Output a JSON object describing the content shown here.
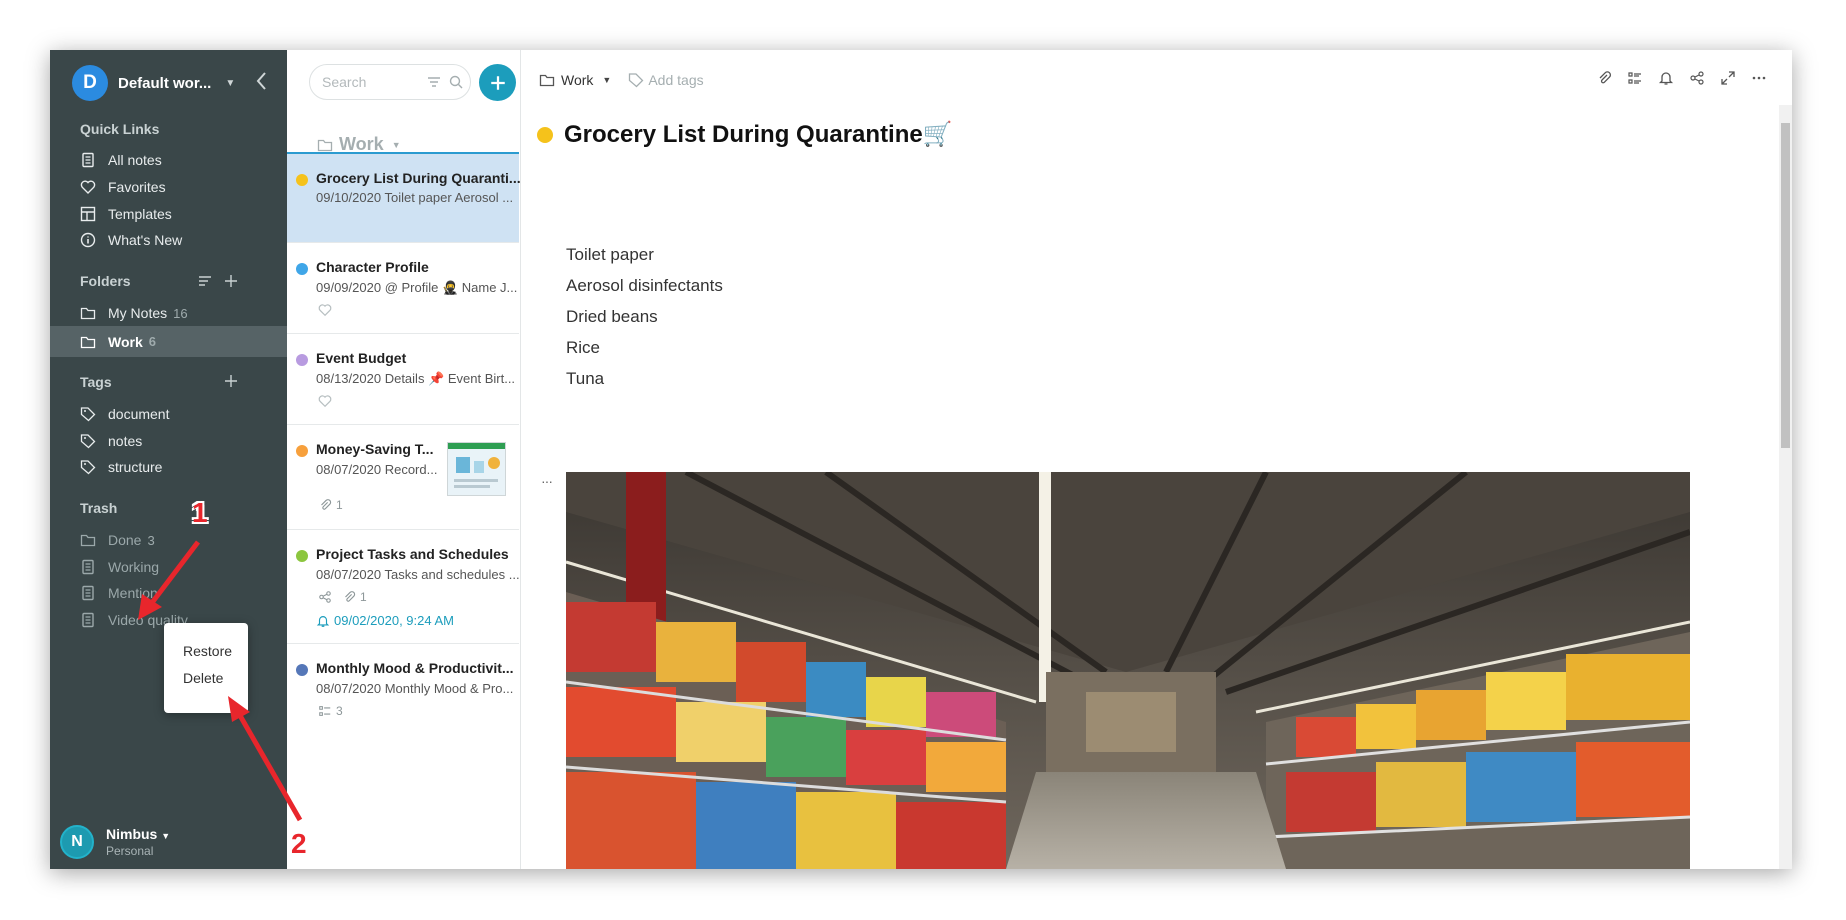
{
  "workspace": {
    "initial": "D",
    "name": "Default wor...",
    "color": "#2b8be0"
  },
  "quick_links": {
    "title": "Quick Links",
    "items": [
      {
        "label": "All notes",
        "icon": "note-icon"
      },
      {
        "label": "Favorites",
        "icon": "heart-icon"
      },
      {
        "label": "Templates",
        "icon": "template-icon"
      },
      {
        "label": "What's New",
        "icon": "info-icon"
      }
    ]
  },
  "folders": {
    "title": "Folders",
    "items": [
      {
        "label": "My Notes",
        "count": "16"
      },
      {
        "label": "Work",
        "count": "6"
      }
    ]
  },
  "tags": {
    "title": "Tags",
    "items": [
      {
        "label": "document"
      },
      {
        "label": "notes"
      },
      {
        "label": "structure"
      }
    ]
  },
  "trash": {
    "title": "Trash",
    "items": [
      {
        "label": "Done",
        "count": "3"
      },
      {
        "label": "Working"
      },
      {
        "label": "Mention"
      },
      {
        "label": "Video quality"
      }
    ]
  },
  "context_menu": {
    "restore": "Restore",
    "delete": "Delete"
  },
  "annotations": {
    "label_1": "1",
    "label_2": "2",
    "color": "#e8262c"
  },
  "user": {
    "initial": "N",
    "name": "Nimbus",
    "plan": "Personal"
  },
  "note_list": {
    "search_placeholder": "Search",
    "folder": "Work",
    "notes": [
      {
        "title": "Grocery List During Quaranti...",
        "date": "09/10/2020",
        "preview": "Toilet paper Aerosol ...",
        "dot": "#f5c21b",
        "selected": true
      },
      {
        "title": "Character Profile",
        "date": "09/09/2020",
        "preview": "@ Profile 🥷 Name J...",
        "dot": "#3fa6e8"
      },
      {
        "title": "Event Budget",
        "date": "08/13/2020",
        "preview": "Details 📌 Event Birt...",
        "dot": "#b89be0"
      },
      {
        "title": "Money-Saving T...",
        "date": "08/07/2020",
        "preview": "Record...",
        "dot": "#f7a03c",
        "attachments": "1"
      },
      {
        "title": "Project Tasks and Schedules",
        "date": "08/07/2020",
        "preview": "Tasks and schedules ...",
        "dot": "#8cc63f",
        "attachments": "1",
        "reminder": "09/02/2020, 9:24 AM"
      },
      {
        "title": "Monthly Mood & Productivit...",
        "date": "08/07/2020",
        "preview": "Monthly Mood & Pro...",
        "dot": "#5577b8",
        "tasks": "3"
      }
    ]
  },
  "editor": {
    "folder": "Work",
    "add_tags": "Add tags",
    "title": "Grocery List During Quarantine🛒",
    "title_dot": "#f5c21b",
    "items": [
      "Toilet paper",
      "Aerosol disinfectants",
      "Dried beans",
      "Rice",
      "Tuna"
    ],
    "block_menu": "···"
  },
  "colors": {
    "sidebar": "#3a4749",
    "accent": "#1c9dbc",
    "selected_note": "#cfe2f3"
  }
}
